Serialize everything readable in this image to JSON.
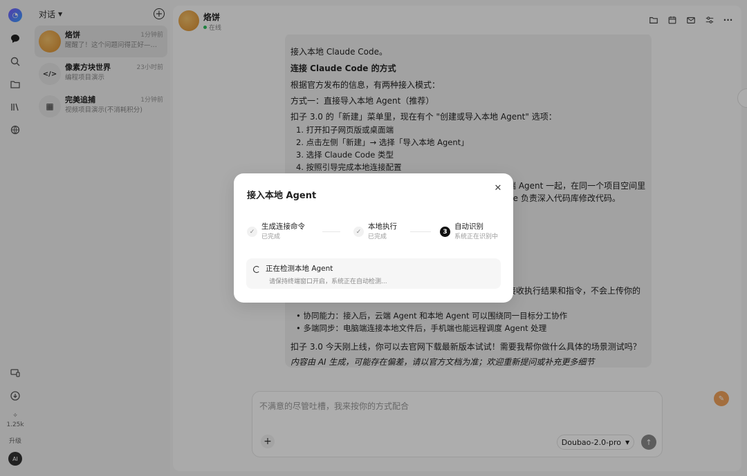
{
  "sidebar": {
    "counter": "1.25k",
    "upgrade_label": "升级",
    "user_avatar": "AI"
  },
  "conversations": {
    "header_title": "对话",
    "items": [
      {
        "name": "烙饼",
        "time": "1分钟前",
        "snippet": "醒醒了！这个问题问得正好——扣...",
        "icon": "avatar"
      },
      {
        "name": "像素方块世界",
        "time": "23小时前",
        "snippet": "编程项目演示",
        "icon": "code-icon"
      },
      {
        "name": "完美追捕",
        "time": "1分钟前",
        "snippet": "视频项目演示(不消耗积分)",
        "icon": "film-icon"
      }
    ]
  },
  "chat": {
    "name": "烙饼",
    "status": "在线",
    "message": {
      "line_intro": "接入本地 Claude Code。",
      "heading": "连接 Claude Code 的方式",
      "para1": "根据官方发布的信息，有两种接入模式：",
      "mode1": "方式一：直接导入本地 Agent（推荐）",
      "para2": "扣子 3.0 的「新建」菜单里，现在有个 \"创建或导入本地 Agent\" 选项：",
      "steps": [
        "打开扣子网页版或桌面端",
        "点击左侧「新建」→ 选择「导入本地 Agent」",
        "选择 Claude Code 类型",
        "按照引导完成本地连接配置"
      ],
      "partial1": "端 Agent 一起，在同一个项目空间里",
      "partial2": "de 负责深入代码库修改代码。",
      "partial3": "接收执行结果和指令，不会上传你的",
      "bullets": [
        "协同能力：接入后，云端 Agent 和本地 Agent 可以围绕同一目标分工协作",
        "多端同步：电脑端连接本地文件后，手机端也能远程调度 Agent 处理"
      ],
      "closing": "扣子 3.0 今天刚上线，你可以去官网下载最新版本试试！需要我帮你做什么具体的场景测试吗？",
      "disclaimer": "内容由 AI 生成，可能存在偏差，请以官方文档为准；欢迎重新提问或补充更多细节"
    },
    "input_placeholder": "不满意的尽管吐槽，我来按你的方式配合",
    "model": "Doubao-2.0-pro"
  },
  "modal": {
    "title": "接入本地 Agent",
    "steps": [
      {
        "label": "生成连接命令",
        "status": "已完成"
      },
      {
        "label": "本地执行",
        "status": "已完成"
      },
      {
        "number": "3",
        "label": "自动识别",
        "status": "系统正在识别中"
      }
    ],
    "detect_title": "正在检测本地 Agent",
    "detect_sub": "请保持终端窗口开启，系统正在自动检测..."
  }
}
